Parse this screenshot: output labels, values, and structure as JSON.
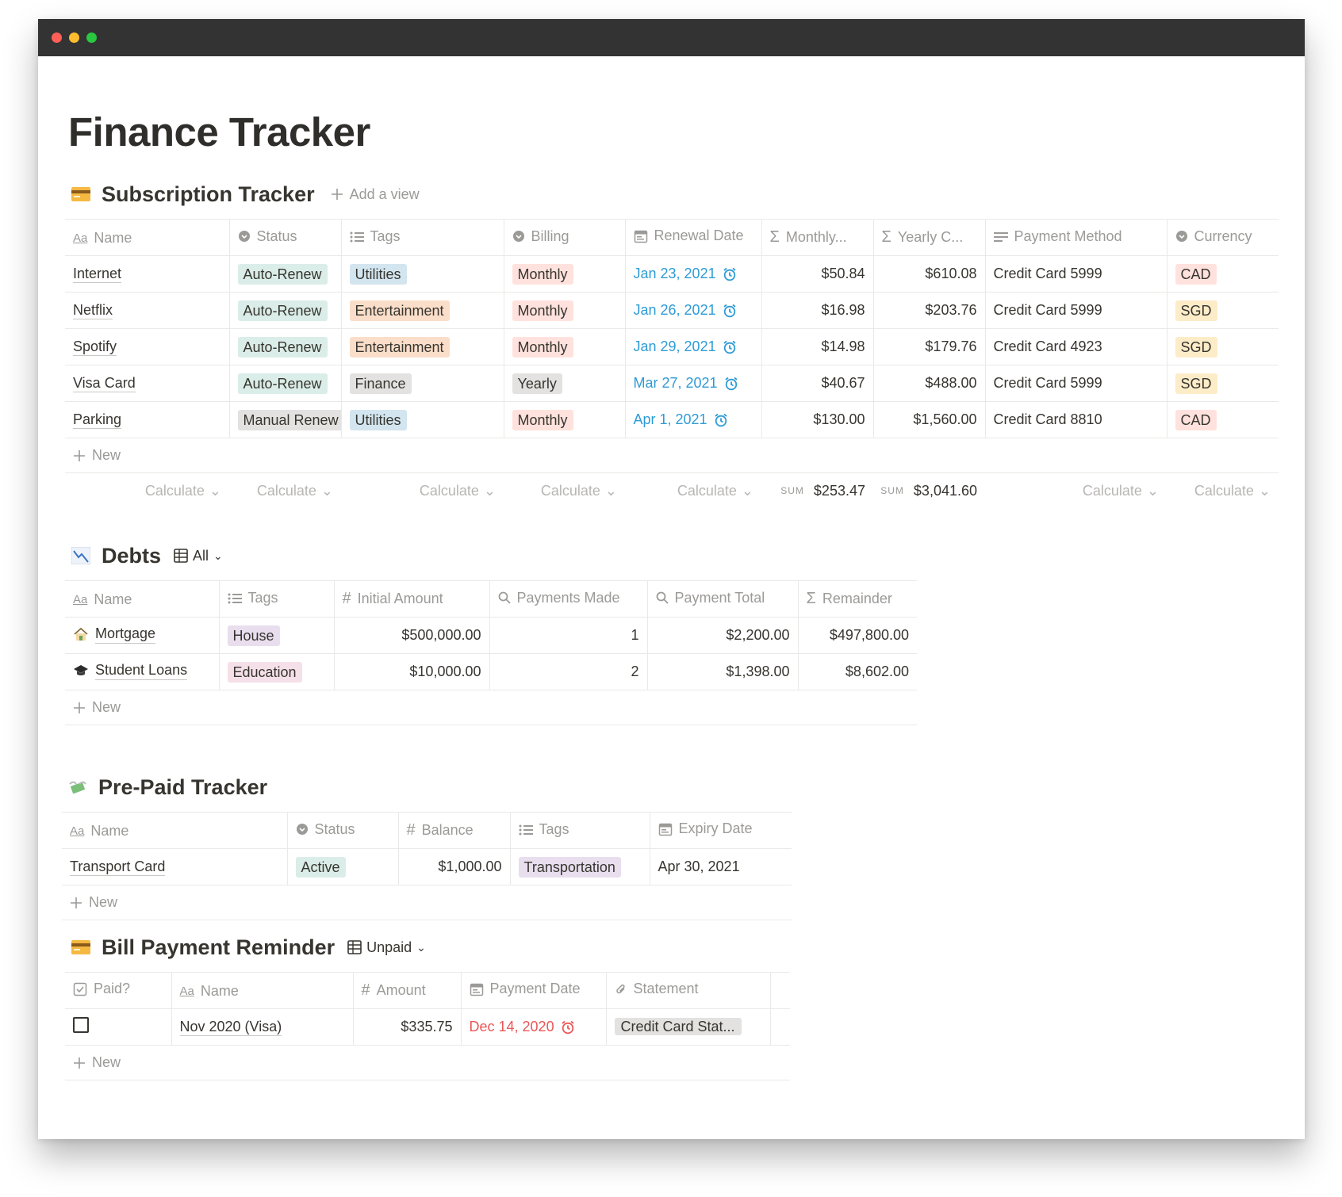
{
  "page": {
    "title": "Finance Tracker"
  },
  "subscriptions": {
    "title": "Subscription Tracker",
    "add_view": "Add a view",
    "columns": [
      "Name",
      "Status",
      "Tags",
      "Billing",
      "Renewal Date",
      "Monthly...",
      "Yearly C...",
      "Payment Method",
      "Currency"
    ],
    "rows": [
      {
        "name": "Internet",
        "status": "Auto-Renew",
        "tag": "Utilities",
        "billing": "Monthly",
        "renewal": "Jan 23, 2021",
        "monthly": "$50.84",
        "yearly": "$610.08",
        "method": "Credit Card 5999",
        "currency": "CAD"
      },
      {
        "name": "Netflix",
        "status": "Auto-Renew",
        "tag": "Entertainment",
        "billing": "Monthly",
        "renewal": "Jan 26, 2021",
        "monthly": "$16.98",
        "yearly": "$203.76",
        "method": "Credit Card 5999",
        "currency": "SGD"
      },
      {
        "name": "Spotify",
        "status": "Auto-Renew",
        "tag": "Entertainment",
        "billing": "Monthly",
        "renewal": "Jan 29, 2021",
        "monthly": "$14.98",
        "yearly": "$179.76",
        "method": "Credit Card 4923",
        "currency": "SGD"
      },
      {
        "name": "Visa Card",
        "status": "Auto-Renew",
        "tag": "Finance",
        "billing": "Yearly",
        "renewal": "Mar 27, 2021",
        "monthly": "$40.67",
        "yearly": "$488.00",
        "method": "Credit Card 5999",
        "currency": "SGD"
      },
      {
        "name": "Parking",
        "status": "Manual Renew",
        "tag": "Utilities",
        "billing": "Monthly",
        "renewal": "Apr 1, 2021",
        "monthly": "$130.00",
        "yearly": "$1,560.00",
        "method": "Credit Card 8810",
        "currency": "CAD"
      }
    ],
    "new_label": "New",
    "calc_label": "Calculate",
    "sum_label": "SUM",
    "sum_monthly": "$253.47",
    "sum_yearly": "$3,041.60"
  },
  "debts": {
    "title": "Debts",
    "view": "All",
    "columns": [
      "Name",
      "Tags",
      "Initial Amount",
      "Payments Made",
      "Payment Total",
      "Remainder"
    ],
    "rows": [
      {
        "name": "Mortgage",
        "tag": "House",
        "initial": "$500,000.00",
        "payments": "1",
        "total": "$2,200.00",
        "remainder": "$497,800.00"
      },
      {
        "name": "Student Loans",
        "tag": "Education",
        "initial": "$10,000.00",
        "payments": "2",
        "total": "$1,398.00",
        "remainder": "$8,602.00"
      }
    ],
    "new_label": "New"
  },
  "prepaid": {
    "title": "Pre-Paid Tracker",
    "columns": [
      "Name",
      "Status",
      "Balance",
      "Tags",
      "Expiry Date"
    ],
    "rows": [
      {
        "name": "Transport Card",
        "status": "Active",
        "balance": "$1,000.00",
        "tag": "Transportation",
        "expiry": "Apr 30, 2021"
      }
    ],
    "new_label": "New"
  },
  "bills": {
    "title": "Bill Payment Reminder",
    "view": "Unpaid",
    "columns": [
      "Paid?",
      "Name",
      "Amount",
      "Payment Date",
      "Statement"
    ],
    "rows": [
      {
        "name": "Nov 2020 (Visa)",
        "amount": "$335.75",
        "date": "Dec 14, 2020",
        "statement": "Credit Card Stat..."
      }
    ],
    "new_label": "New"
  },
  "colors": {
    "date_blue": "#2e9bd6",
    "date_red": "#eb5757",
    "titlebar": "#333333"
  }
}
